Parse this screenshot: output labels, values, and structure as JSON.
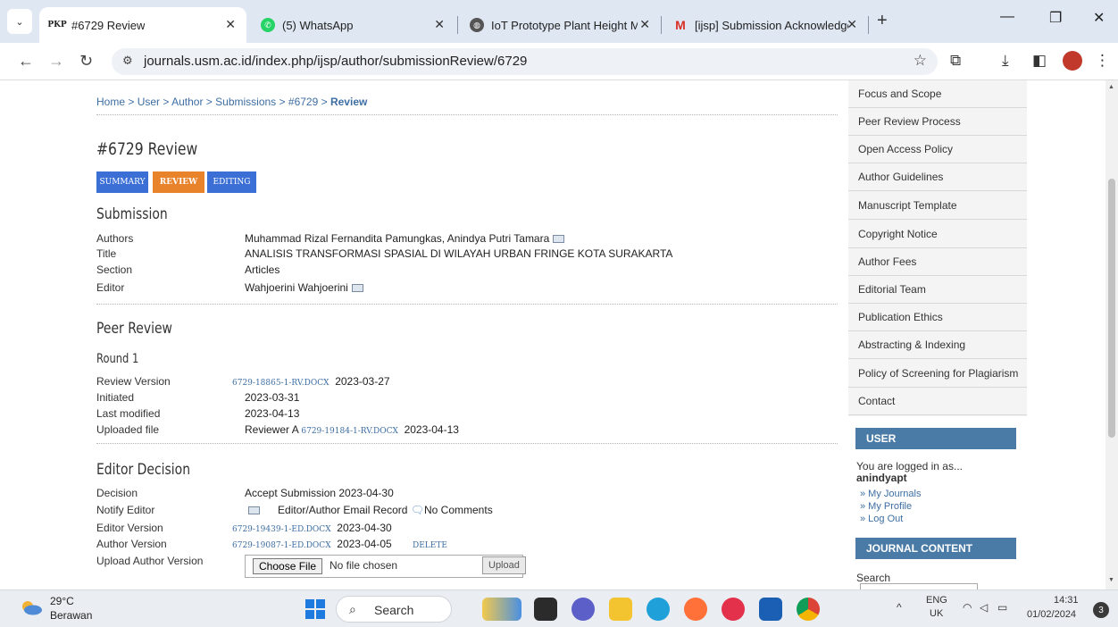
{
  "browser": {
    "tabs": [
      {
        "favicon": "PKP",
        "title": "#6729 Review",
        "active": true
      },
      {
        "favicon": "whatsapp-icon",
        "title": "(5) WhatsApp",
        "active": false
      },
      {
        "favicon": "globe-icon",
        "title": "IoT Prototype Plant Height Mea",
        "active": false
      },
      {
        "favicon": "gmail-icon",
        "title": "[ijsp] Submission Acknowledge",
        "active": false
      }
    ],
    "new_tab": "+",
    "url": "journals.usm.ac.id/index.php/ijsp/author/submissionReview/6729"
  },
  "breadcrumb": {
    "home": "Home",
    "sep": ">",
    "user": "User",
    "author": "Author",
    "submissions": "Submissions",
    "id": "#6729",
    "current": "Review"
  },
  "page": {
    "title": "#6729 Review",
    "tabs": [
      "Summary",
      "Review",
      "Editing"
    ],
    "tab_colors": {
      "summary": "#3b6fd6",
      "review": "#e8822b",
      "editing": "#3b6fd6"
    }
  },
  "submission": {
    "heading": "Submission",
    "authors_label": "Authors",
    "authors": "Muhammad Rizal Fernandita Pamungkas, Anindya Putri Tamara",
    "title_label": "Title",
    "title": "ANALISIS TRANSFORMASI SPASIAL DI WILAYAH URBAN FRINGE KOTA SURAKARTA",
    "section_label": "Section",
    "section": "Articles",
    "editor_label": "Editor",
    "editor": "Wahjoerini Wahjoerini"
  },
  "peer_review": {
    "heading": "Peer Review",
    "round": "Round 1",
    "review_version_label": "Review Version",
    "review_version_file": "6729-18865-1-RV.DOCX",
    "review_version_date": "2023-03-27",
    "initiated_label": "Initiated",
    "initiated": "2023-03-31",
    "last_modified_label": "Last modified",
    "last_modified": "2023-04-13",
    "uploaded_file_label": "Uploaded file",
    "uploaded_reviewer": "Reviewer A",
    "uploaded_file": "6729-19184-1-RV.DOCX",
    "uploaded_date": "2023-04-13"
  },
  "editor_decision": {
    "heading": "Editor Decision",
    "decision_label": "Decision",
    "decision": "Accept Submission 2023-04-30",
    "notify_label": "Notify Editor",
    "email_record": "Editor/Author Email Record",
    "comments": "No Comments",
    "editor_version_label": "Editor Version",
    "editor_version_file": "6729-19439-1-ED.DOCX",
    "editor_version_date": "2023-04-30",
    "author_version_label": "Author Version",
    "author_version_file": "6729-19087-1-ED.DOCX",
    "author_version_date": "2023-04-05",
    "delete": "DELETE",
    "upload_label": "Upload Author Version",
    "choose_file": "Choose File",
    "no_file": "No file chosen",
    "upload_button": "Upload"
  },
  "sidebar": {
    "items": [
      "Focus and Scope",
      "Peer Review Process",
      "Open Access Policy",
      "Author Guidelines",
      "Manuscript Template",
      "Copyright Notice",
      "Author Fees",
      "Editorial Team",
      "Publication Ethics",
      "Abstracting & Indexing",
      "Policy of Screening for Plagiarism",
      "Contact"
    ],
    "user_heading": "USER",
    "logged_in_as": "You are logged in as...",
    "username": "anindyapt",
    "user_links": [
      "» My Journals",
      "» My Profile",
      "» Log Out"
    ],
    "journal_content_heading": "JOURNAL CONTENT",
    "search_label": "Search"
  },
  "taskbar": {
    "temperature": "29°C",
    "weather": "Berawan",
    "search": "Search",
    "lang_top": "ENG",
    "lang_bottom": "UK",
    "time": "14:31",
    "date": "01/02/2024",
    "notifications": "3"
  },
  "colors": {
    "header_blue": "#4a7ba6",
    "link_blue": "#3d6ea3",
    "review_orange": "#e8822b"
  }
}
